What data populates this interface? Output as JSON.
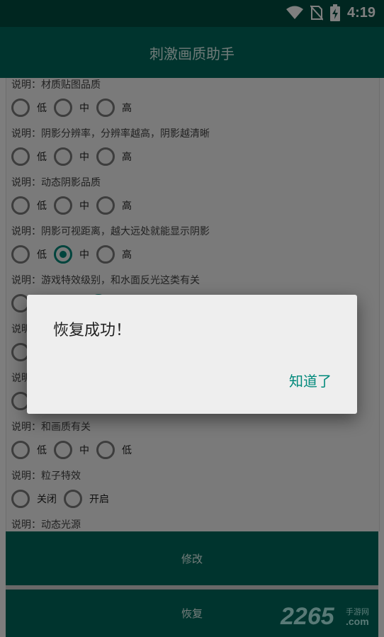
{
  "status_bar": {
    "time": "4:19",
    "icons": [
      "wifi-icon",
      "no-sim-icon",
      "battery-charging-icon"
    ]
  },
  "app_bar": {
    "title": "刺激画质助手"
  },
  "sections": [
    {
      "description": "说明：材质贴图品质",
      "options": [
        "低",
        "中",
        "高"
      ],
      "selected": null
    },
    {
      "description": "说明：阴影分辨率，分辨率越高，阴影越清晰",
      "options": [
        "低",
        "中",
        "高"
      ],
      "selected": null
    },
    {
      "description": "说明：动态阴影品质",
      "options": [
        "低",
        "中",
        "高"
      ],
      "selected": null
    },
    {
      "description": "说明：阴影可视距离，越大远处就能显示阴影",
      "options": [
        "低",
        "中",
        "高"
      ],
      "selected": 1
    },
    {
      "description": "说明：游戏特效级别，和水面反光这类有关",
      "options": [],
      "selected": null
    },
    {
      "description": "说明：和画质有关",
      "options": [
        "低",
        "中",
        "低"
      ],
      "selected": null
    },
    {
      "description": "说明：粒子特效",
      "options": [
        "关闭",
        "开启"
      ],
      "selected": null
    },
    {
      "description": "说明：动态光源",
      "options": [],
      "selected": null
    }
  ],
  "partial_label": "说明",
  "buttons": {
    "modify": "修改",
    "restore": "恢复"
  },
  "dialog": {
    "message": "恢复成功！",
    "confirm": "知道了"
  },
  "watermark": {
    "number": "2265",
    "sub": "手游网",
    "domain": ".com"
  },
  "colors": {
    "primary": "#00695c",
    "primary_dark": "#004d40",
    "accent": "#00897b"
  }
}
